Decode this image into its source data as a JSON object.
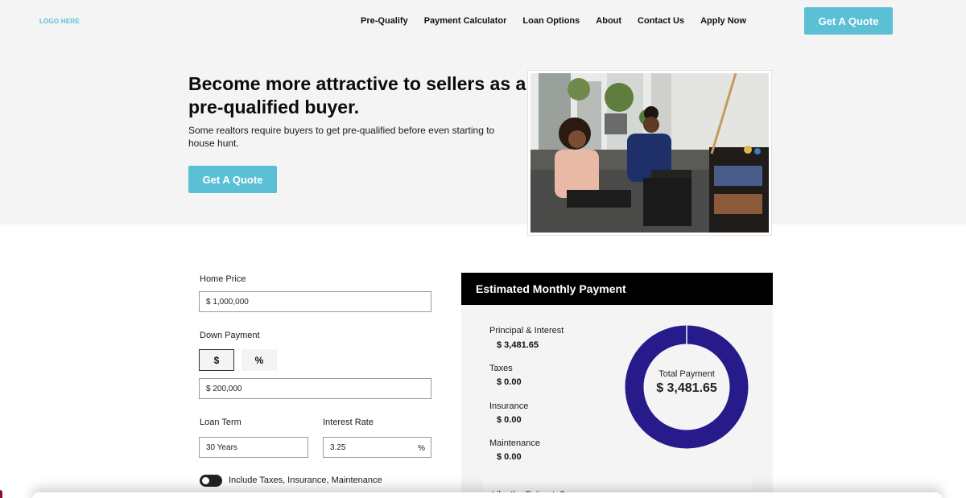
{
  "header": {
    "logo": "LOGO HERE",
    "nav": [
      "Pre-Qualify",
      "Payment Calculator",
      "Loan Options",
      "About",
      "Contact Us",
      "Apply Now"
    ],
    "cta_label": "Get A Quote"
  },
  "hero": {
    "title": "Become more attractive to sellers as a pre-qualified buyer.",
    "subtitle": "Some realtors require buyers to get pre-qualified before even starting to house hunt.",
    "cta_label": "Get A Quote"
  },
  "calculator": {
    "home_price_label": "Home Price",
    "home_price_value": "$ 1,000,000",
    "down_payment_label": "Down Payment",
    "down_payment_mode_dollar": "$",
    "down_payment_mode_percent": "%",
    "down_payment_value": "$ 200,000",
    "loan_term_label": "Loan Term",
    "loan_term_value": "30 Years",
    "interest_rate_label": "Interest Rate",
    "interest_rate_value": "3.25",
    "interest_rate_suffix": "%",
    "include_toggle_label": "Include Taxes, Insurance, Maintenance",
    "include_toggle_on": false
  },
  "results": {
    "header": "Estimated Monthly Payment",
    "breakdown": [
      {
        "label": "Principal & Interest",
        "value": "$ 3,481.65"
      },
      {
        "label": "Taxes",
        "value": "$ 0.00"
      },
      {
        "label": "Insurance",
        "value": "$ 0.00"
      },
      {
        "label": "Maintenance",
        "value": "$ 0.00"
      }
    ],
    "total_label": "Total Payment",
    "total_value": "$ 3,481.65",
    "estimate_prompt": "Like the Estimate?"
  },
  "colors": {
    "accent": "#5bc0d6",
    "donut": "#271a8a",
    "band_bg": "#f4f4f4",
    "panel_header": "#000000"
  }
}
